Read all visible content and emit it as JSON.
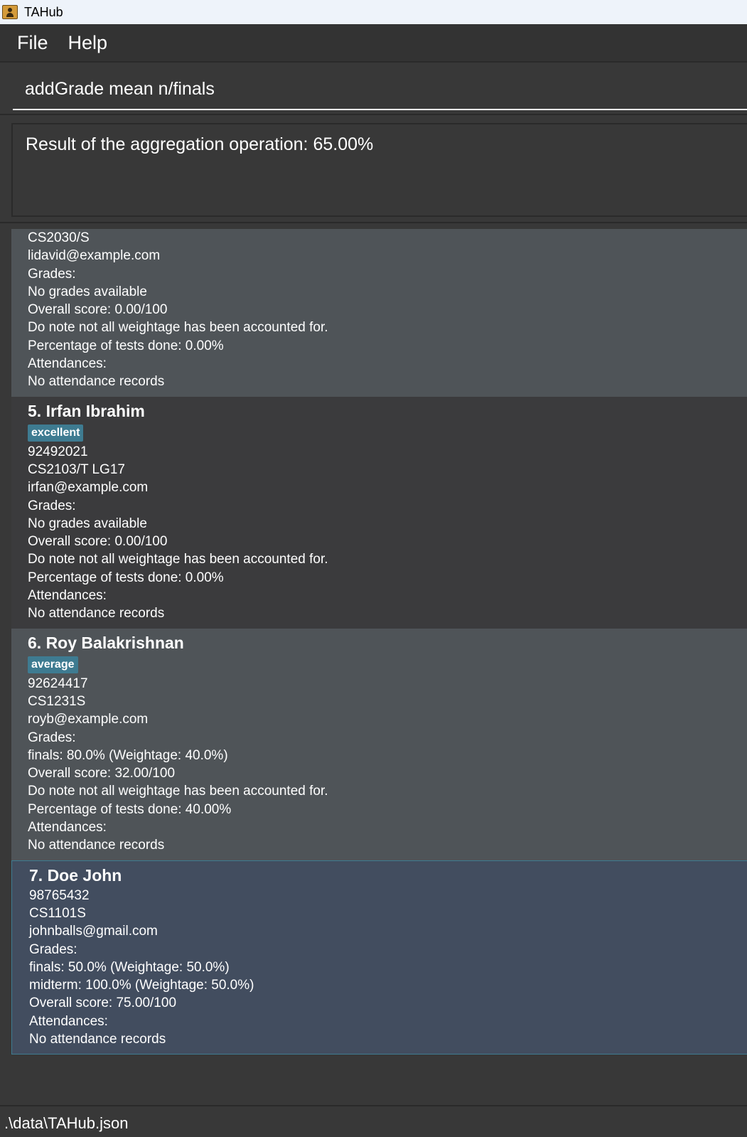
{
  "window": {
    "title": "TAHub"
  },
  "menu": {
    "file": "File",
    "help": "Help"
  },
  "command": {
    "value": "addGrade mean n/finals"
  },
  "result": {
    "text": "Result of the aggregation operation: 65.00%"
  },
  "persons": [
    {
      "name": "",
      "tag": "",
      "lines": [
        "CS2030/S",
        "lidavid@example.com",
        "Grades:",
        "No grades available",
        "Overall score: 0.00/100",
        "Do note not all weightage has been accounted for.",
        "Percentage of tests done: 0.00%",
        "Attendances:",
        "No attendance records"
      ]
    },
    {
      "name": "5. Irfan Ibrahim",
      "tag": "excellent",
      "lines": [
        "92492021",
        "CS2103/T LG17",
        "irfan@example.com",
        "Grades:",
        "No grades available",
        "Overall score: 0.00/100",
        "Do note not all weightage has been accounted for.",
        "Percentage of tests done: 0.00%",
        "Attendances:",
        "No attendance records"
      ]
    },
    {
      "name": "6. Roy Balakrishnan",
      "tag": "average",
      "lines": [
        "92624417",
        "CS1231S",
        "royb@example.com",
        "Grades:",
        "finals: 80.0% (Weightage: 40.0%)",
        "Overall score: 32.00/100",
        "Do note not all weightage has been accounted for.",
        "Percentage of tests done: 40.00%",
        "Attendances:",
        "No attendance records"
      ]
    },
    {
      "name": "7. Doe John",
      "tag": "",
      "lines": [
        "98765432",
        "CS1101S",
        "johnballs@gmail.com",
        "Grades:",
        "finals: 50.0% (Weightage: 50.0%)",
        "midterm: 100.0% (Weightage: 50.0%)",
        "Overall score: 75.00/100",
        "Attendances:",
        "No attendance records"
      ]
    }
  ],
  "status": {
    "path": ".\\data\\TAHub.json"
  }
}
